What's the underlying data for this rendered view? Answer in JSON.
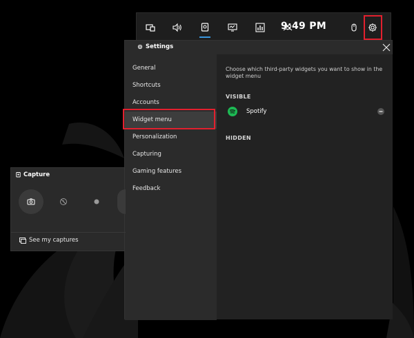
{
  "topbar": {
    "clock": "9:49 PM",
    "buttons": [
      {
        "icon": "widget-menu-icon"
      },
      {
        "icon": "audio-icon"
      },
      {
        "icon": "capture-icon",
        "active": true
      },
      {
        "icon": "performance-icon"
      },
      {
        "icon": "resources-icon"
      },
      {
        "icon": "xbox-social-icon"
      }
    ],
    "accent": "#3a96dd",
    "highlight_color": "#e3202e"
  },
  "settings": {
    "title": "Settings",
    "nav": [
      {
        "label": "General"
      },
      {
        "label": "Shortcuts"
      },
      {
        "label": "Accounts"
      },
      {
        "label": "Widget menu",
        "active": true
      },
      {
        "label": "Personalization"
      },
      {
        "label": "Capturing"
      },
      {
        "label": "Gaming features"
      },
      {
        "label": "Feedback"
      }
    ],
    "content": {
      "description": "Choose which third-party widgets you want to show in the widget menu",
      "visible_label": "VISIBLE",
      "hidden_label": "HIDDEN",
      "visible_widgets": [
        {
          "name": "Spotify",
          "brand_color": "#1db954"
        }
      ]
    }
  },
  "capture": {
    "title": "Capture",
    "see_captures": "See my captures"
  }
}
